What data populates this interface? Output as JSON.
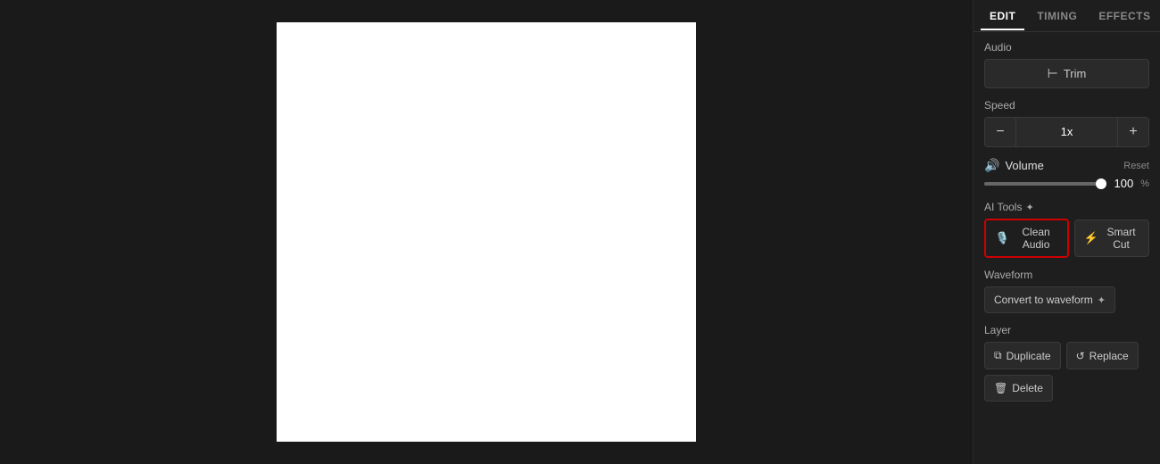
{
  "tabs": [
    {
      "id": "edit",
      "label": "EDIT",
      "active": true
    },
    {
      "id": "timing",
      "label": "TIMING",
      "active": false
    },
    {
      "id": "effects",
      "label": "EFFECTS",
      "active": false
    }
  ],
  "sections": {
    "audio": {
      "label": "Audio",
      "trim_button": "Trim"
    },
    "speed": {
      "label": "Speed",
      "decrease": "−",
      "value": "1x",
      "increase": "+"
    },
    "volume": {
      "label": "Volume",
      "reset_label": "Reset",
      "value": "100",
      "percent": "%",
      "slider_fill": 100
    },
    "ai_tools": {
      "label": "AI Tools",
      "clean_audio_label": "Clean Audio",
      "smart_cut_label": "Smart Cut"
    },
    "waveform": {
      "label": "Waveform",
      "convert_label": "Convert to waveform"
    },
    "layer": {
      "label": "Layer",
      "duplicate_label": "Duplicate",
      "replace_label": "Replace",
      "delete_label": "Delete"
    }
  }
}
